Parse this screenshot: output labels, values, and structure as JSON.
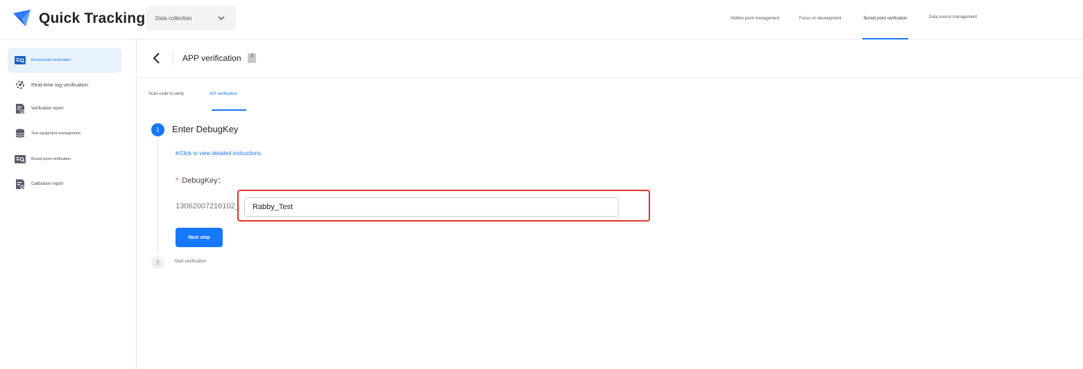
{
  "app": {
    "title": "Quick Tracking"
  },
  "header": {
    "project_select": "Data collection",
    "nav": [
      {
        "label": "Hidden point management"
      },
      {
        "label": "Focus on development"
      },
      {
        "label": "Buried point verification",
        "active": true
      },
      {
        "label": "Data source management"
      }
    ]
  },
  "sidebar": {
    "items": [
      {
        "label": "Buried point verification",
        "icon": "verify-icon",
        "active": true
      },
      {
        "label": "Real-time log verification",
        "icon": "realtime-log-icon"
      },
      {
        "label": "Verification report",
        "icon": "report-icon"
      },
      {
        "label": "Test equipment management",
        "icon": "database-icon"
      },
      {
        "label": "Buried point verification",
        "icon": "verify-icon"
      },
      {
        "label": "Calibration report",
        "icon": "report-icon"
      }
    ]
  },
  "page": {
    "title": "APP verification",
    "tabs": [
      {
        "label": "Scan code to verify"
      },
      {
        "label": "API verification",
        "active": true
      }
    ],
    "steps": [
      {
        "number": "1",
        "title": "Enter DebugKey",
        "status": "active"
      },
      {
        "number": "2",
        "title": "Start verification",
        "status": "waiting"
      }
    ],
    "instructions_link": "※Click to view detailed instructions",
    "debugkey": {
      "required_mark": "*",
      "label": "DebugKey：",
      "prefix": "13062007216102_",
      "value": "Rabby_Test"
    },
    "next_button": "Next step"
  },
  "colors": {
    "primary": "#1677ff",
    "highlight": "#e0322b",
    "active_bg": "#e8f1fe"
  }
}
